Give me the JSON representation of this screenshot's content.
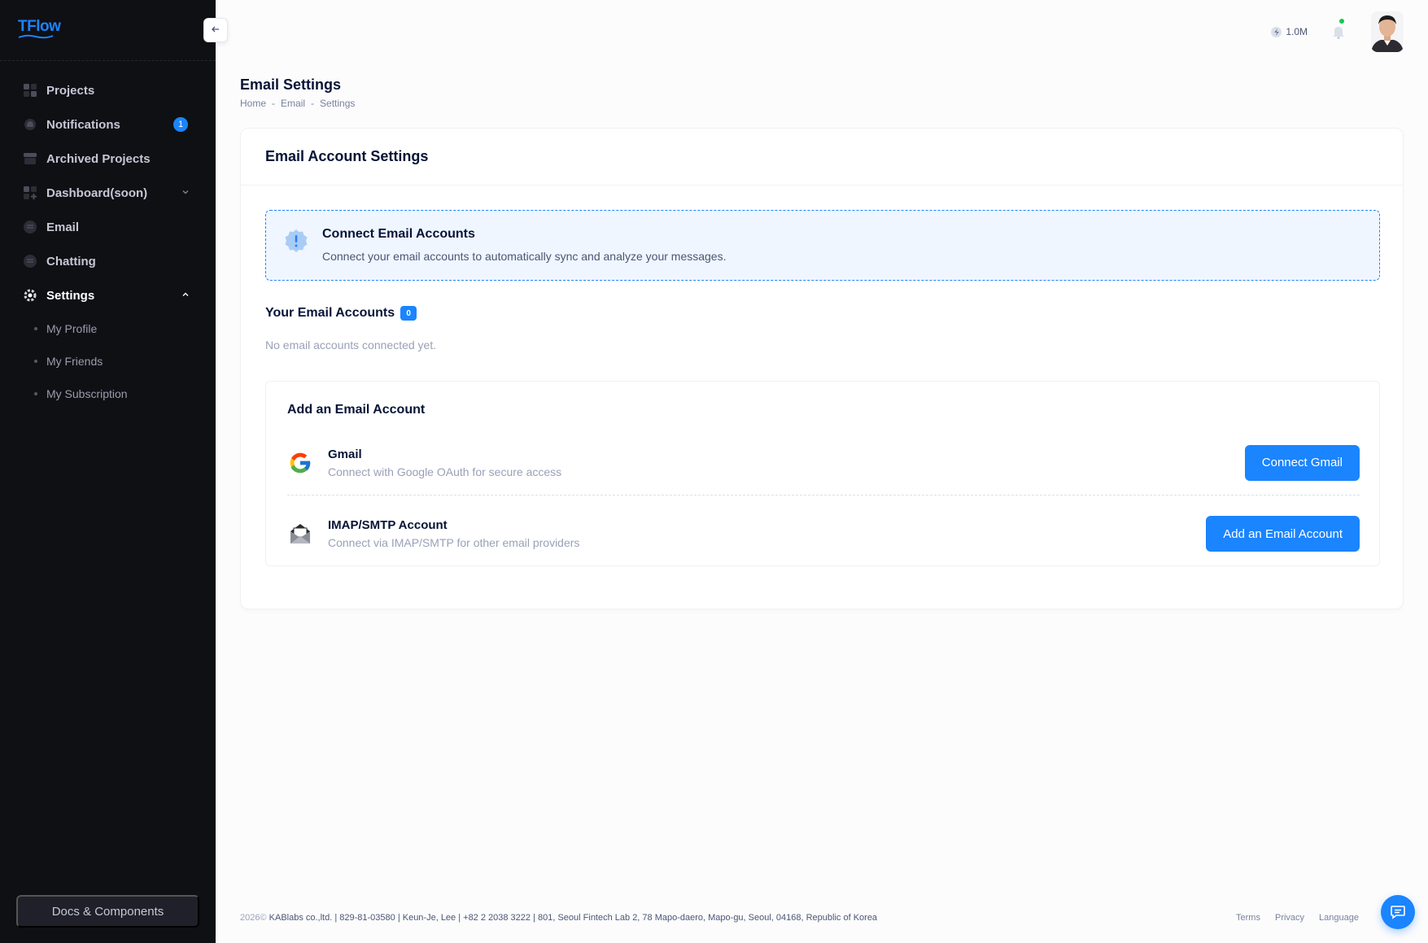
{
  "brand": {
    "logo_text": "TFlow",
    "color": "#1b84ff"
  },
  "sidebar": {
    "items": [
      {
        "label": "Projects",
        "icon": "grid-icon"
      },
      {
        "label": "Notifications",
        "icon": "bell-icon",
        "badge": "1"
      },
      {
        "label": "Archived Projects",
        "icon": "archive-icon"
      },
      {
        "label": "Dashboard(soon)",
        "icon": "dashboard-icon"
      },
      {
        "label": "Email",
        "icon": "message-icon"
      },
      {
        "label": "Chatting",
        "icon": "chat-icon"
      },
      {
        "label": "Settings",
        "icon": "gear-icon"
      }
    ],
    "settings_sub": [
      "My Profile",
      "My Friends",
      "My Subscription"
    ],
    "docs_button": "Docs & Components"
  },
  "header": {
    "credits": "1.0M"
  },
  "page": {
    "title": "Email Settings",
    "breadcrumb": [
      "Home",
      "Email",
      "Settings"
    ]
  },
  "card": {
    "title": "Email Account Settings",
    "notice": {
      "title": "Connect Email Accounts",
      "desc": "Connect your email accounts to automatically sync and analyze your messages."
    },
    "accounts_title": "Your Email Accounts",
    "accounts_count": "0",
    "empty_text": "No email accounts connected yet.",
    "add": {
      "title": "Add an Email Account",
      "providers": [
        {
          "name": "Gmail",
          "desc": "Connect with Google OAuth for secure access",
          "button": "Connect Gmail",
          "icon": "google-icon"
        },
        {
          "name": "IMAP/SMTP Account",
          "desc": "Connect via IMAP/SMTP for other email providers",
          "button": "Add an Email Account",
          "icon": "envelope-icon"
        }
      ]
    }
  },
  "footer": {
    "year": "2026©",
    "company": "KABlabs co.,ltd. | 829-81-03580 | Keun-Je, Lee | +82 2 2038 3222 | 801, Seoul Fintech Lab 2, 78 Mapo-daero, Mapo-gu, Seoul, 04168, Republic of Korea",
    "links": [
      "Terms",
      "Privacy",
      "Language"
    ]
  }
}
